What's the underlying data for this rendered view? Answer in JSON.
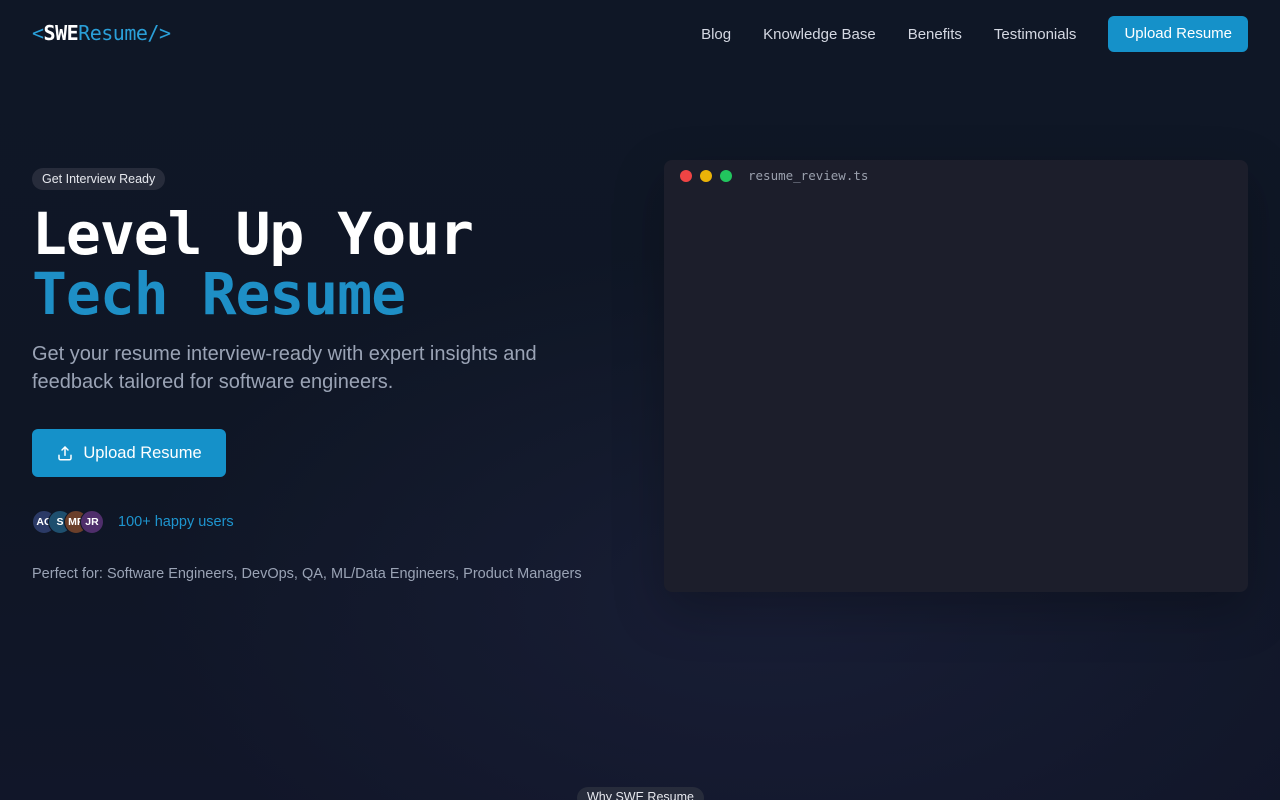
{
  "header": {
    "logo": {
      "open_bracket": "<",
      "swe": "SWE",
      "resume": "Resume",
      "close_bracket": "/>"
    },
    "nav": [
      {
        "label": "Blog"
      },
      {
        "label": "Knowledge Base"
      },
      {
        "label": "Benefits"
      },
      {
        "label": "Testimonials"
      }
    ],
    "cta_label": "Upload Resume"
  },
  "hero": {
    "badge": "Get Interview Ready",
    "headline_line1": "Level Up Your",
    "headline_line2": "Tech Resume",
    "subtitle": "Get your resume interview-ready with expert insights and feedback tailored for software engineers.",
    "cta_label": "Upload Resume",
    "cta_icon": "upload-icon",
    "avatars": [
      {
        "initials": "AC",
        "color": "#2b3a66"
      },
      {
        "initials": "S",
        "color": "#1e4f6e"
      },
      {
        "initials": "MP",
        "color": "#6b3f2a"
      },
      {
        "initials": "JR",
        "color": "#4f2e6b"
      }
    ],
    "users_text": "100+ happy users",
    "perfect_for": "Perfect for: Software Engineers, DevOps, QA, ML/Data Engineers, Product Managers"
  },
  "code_window": {
    "title": "resume_review.ts",
    "dot_colors": [
      "#ef4444",
      "#eab308",
      "#22c55e"
    ]
  },
  "next_section": {
    "badge": "Why SWE Resume"
  },
  "colors": {
    "accent": "#1591c9",
    "background": "#0f1625",
    "window": "#1c1e2b"
  }
}
